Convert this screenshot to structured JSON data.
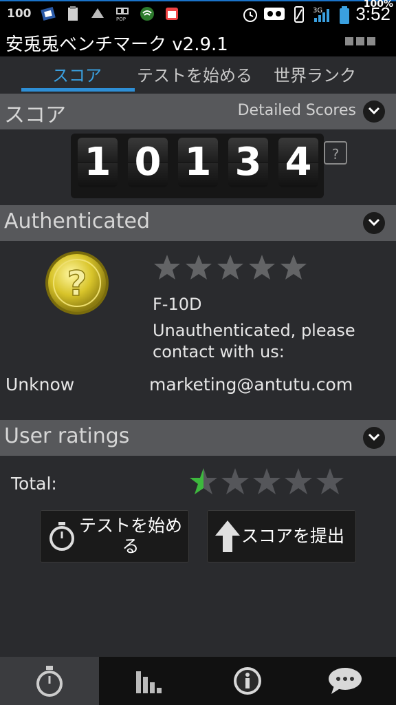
{
  "status_bar": {
    "left_number": "100",
    "battery_percent": "100%",
    "network": "3G",
    "time": "3:52"
  },
  "app": {
    "title": "安兎兎ベンチマーク v2.9.1"
  },
  "tabs": [
    {
      "label": "スコア",
      "active": true
    },
    {
      "label": "テストを始める",
      "active": false
    },
    {
      "label": "世界ランク",
      "active": false
    }
  ],
  "score_section": {
    "title": "スコア",
    "detailed_label": "Detailed Scores",
    "digits": [
      "1",
      "0",
      "1",
      "3",
      "4"
    ],
    "help_label": "?"
  },
  "authenticated_section": {
    "title": "Authenticated",
    "medal_symbol": "?",
    "star_rating": 0,
    "model": "F-10D",
    "message_line1": "Unauthenticated, please",
    "message_line2": "contact with us:",
    "status": "Unknow",
    "email": "marketing@antutu.com"
  },
  "user_ratings_section": {
    "title": "User ratings",
    "total_label": "Total:",
    "rating": 0.5,
    "max_rating": 5
  },
  "buttons": {
    "start_test_line1": "テストを始め",
    "start_test_line2": "る",
    "submit_score": "スコアを提出"
  },
  "bottom_nav": [
    {
      "icon": "stopwatch-icon",
      "active": true
    },
    {
      "icon": "bar-chart-icon",
      "active": false
    },
    {
      "icon": "info-icon",
      "active": false
    },
    {
      "icon": "chat-bubble-icon",
      "active": false
    }
  ],
  "colors": {
    "accent": "#2e8fd6",
    "star_green": "#3db83d",
    "medal_gold": "#d8c42a"
  }
}
